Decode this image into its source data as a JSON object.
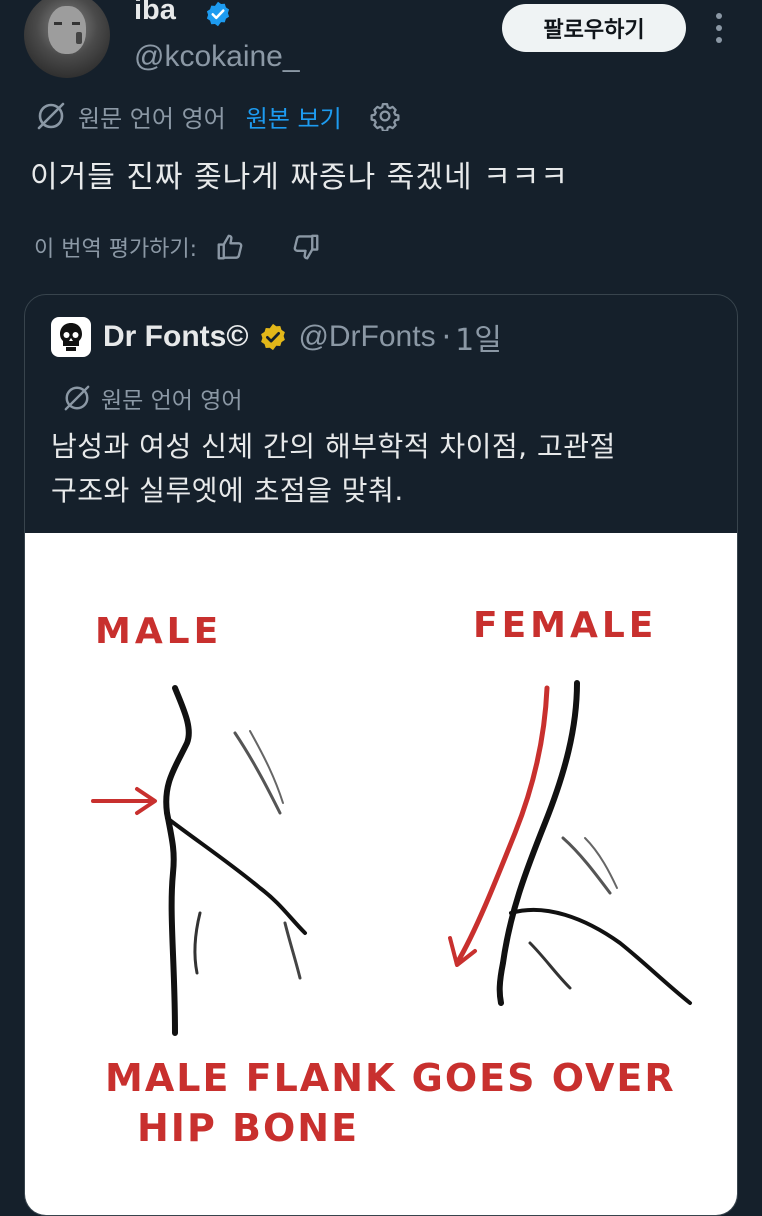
{
  "tweet": {
    "author_name": "iba",
    "author_handle": "@kcokaine_",
    "follow_label": "팔로우하기",
    "translation_label": "원문 언어 영어",
    "show_original_label": "원본 보기",
    "text": "이거들 진짜 좆나게 짜증나 죽겠네 ㅋㅋㅋ",
    "rate_label": "이 번역 평가하기:"
  },
  "quote": {
    "author_name": "Dr Fonts©",
    "author_handle": "@DrFonts",
    "separator": "·",
    "time": "1일",
    "translation_label": "원문 언어 영어",
    "text_line1": "남성과 여성 신체 간의 해부학적 차이점, 고관절",
    "text_line2": "구조와 실루엣에 초점을 맞춰.",
    "image": {
      "label_male": "MALE",
      "label_female": "FEMALE",
      "caption_line1": "MALE FLANK GOES OVER",
      "caption_line2": "HIP BONE"
    }
  },
  "colors": {
    "background": "#15202b",
    "text": "#e7e9ea",
    "muted": "#8b98a5",
    "link": "#1d9bf0",
    "verified_blue": "#1d9bf0",
    "verified_gold": "#e2b719",
    "drawing_red": "#c8302e"
  },
  "icons": [
    "verified-badge-icon",
    "more-icon",
    "translate-icon",
    "gear-icon",
    "thumbs-up-icon",
    "thumbs-down-icon",
    "gold-verified-badge-icon"
  ]
}
